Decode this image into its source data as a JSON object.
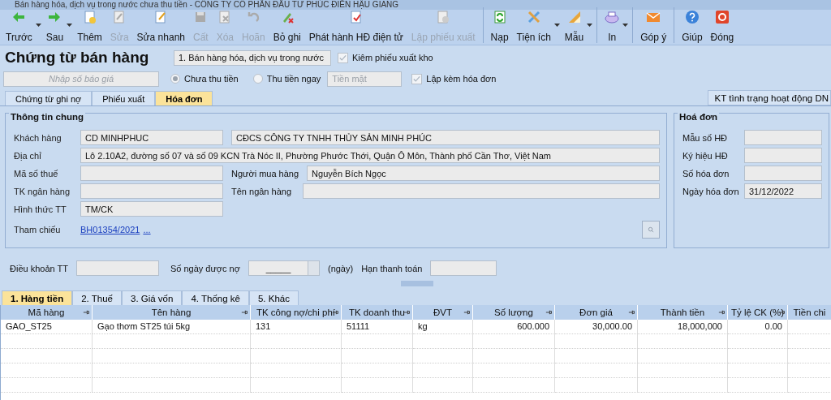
{
  "window": {
    "title": "Bán hàng hóa, dịch vụ trong nước chưa thu tiền - CÔNG TY CỔ PHẦN ĐẦU TƯ PHÚC ĐIỀN HẬU GIANG"
  },
  "toolbar": [
    {
      "label": "Trước",
      "disabled": false,
      "dropdown": true,
      "separator_before": false
    },
    {
      "label": "Sau",
      "disabled": false,
      "dropdown": true,
      "separator_before": false
    },
    {
      "label": "Thêm",
      "disabled": false,
      "dropdown": false,
      "separator_before": false
    },
    {
      "label": "Sửa",
      "disabled": true,
      "dropdown": false,
      "separator_before": false
    },
    {
      "label": "Sửa nhanh",
      "disabled": false,
      "dropdown": false,
      "separator_before": false
    },
    {
      "label": "Cất",
      "disabled": true,
      "dropdown": false,
      "separator_before": false
    },
    {
      "label": "Xóa",
      "disabled": true,
      "dropdown": false,
      "separator_before": false
    },
    {
      "label": "Hoãn",
      "disabled": true,
      "dropdown": false,
      "separator_before": false
    },
    {
      "label": "Bỏ ghi",
      "disabled": false,
      "dropdown": false,
      "separator_before": false
    },
    {
      "label": "Phát hành HĐ điện tử",
      "disabled": false,
      "dropdown": false,
      "separator_before": false
    },
    {
      "label": "Lập phiếu xuất",
      "disabled": true,
      "dropdown": false,
      "separator_before": false
    },
    {
      "label": "Nạp",
      "disabled": false,
      "dropdown": false,
      "separator_before": true
    },
    {
      "label": "Tiện ích",
      "disabled": false,
      "dropdown": true,
      "separator_before": false
    },
    {
      "label": "Mẫu",
      "disabled": false,
      "dropdown": true,
      "separator_before": false
    },
    {
      "label": "In",
      "disabled": false,
      "dropdown": true,
      "separator_before": true
    },
    {
      "label": "Góp ý",
      "disabled": false,
      "dropdown": false,
      "separator_before": true
    },
    {
      "label": "Giúp",
      "disabled": false,
      "dropdown": false,
      "separator_before": true
    },
    {
      "label": "Đóng",
      "disabled": false,
      "dropdown": false,
      "separator_before": false
    }
  ],
  "header": {
    "title": "Chứng từ bán hàng",
    "voucher_type": "1. Bán hàng hóa, dịch vụ trong nước",
    "export_checkbox": {
      "label": "Kiêm phiếu xuất kho",
      "checked": true
    },
    "quote_field": {
      "placeholder": "Nhập số báo giá"
    },
    "payment_radios": [
      {
        "label": "Chưa thu tiền",
        "selected": true
      },
      {
        "label": "Thu tiền ngay",
        "selected": false
      }
    ],
    "payment_field": {
      "placeholder": "Tiền mặt"
    },
    "invoice_checkbox": {
      "label": "Lập kèm hóa đơn",
      "checked": true
    }
  },
  "tabs": [
    {
      "label": "Chứng từ ghi nợ",
      "selected": false
    },
    {
      "label": "Phiếu xuất",
      "selected": false
    },
    {
      "label": "Hóa đơn",
      "selected": true
    }
  ],
  "status_button": {
    "label": "KT tình trạng hoạt động DN"
  },
  "general_info": {
    "title": "Thông tin chung",
    "customer": {
      "label": "Khách hàng",
      "code": "CD MINHPHUC",
      "name": "CĐCS CÔNG TY TNHH THỦY SẢN MINH PHÚC"
    },
    "address": {
      "label": "Địa chỉ",
      "value": "Lô 2.10A2, đường số 07 và số 09 KCN Trà Nóc II, Phường Phước Thới, Quận Ô Môn, Thành phố Cần Thơ, Việt Nam"
    },
    "tax_code": {
      "label": "Mã số thuế"
    },
    "buyer": {
      "label": "Người mua hàng",
      "value": "Nguyễn Bích Ngọc"
    },
    "bank_account": {
      "label": "TK ngân hàng"
    },
    "bank_name": {
      "label": "Tên ngân hàng"
    },
    "payment_method": {
      "label": "Hình thức TT",
      "value": "TM/CK"
    },
    "reference": {
      "label": "Tham chiếu",
      "link": "BH01354/2021",
      "more": "..."
    }
  },
  "invoice": {
    "title": "Hoá đơn",
    "fields": [
      {
        "label": "Mẫu số HĐ"
      },
      {
        "label": "Ký hiệu HĐ"
      },
      {
        "label": "Số hóa đơn"
      },
      {
        "label": "Ngày hóa đơn",
        "value": "31/12/2022"
      }
    ]
  },
  "terms": {
    "terms_label": "Điều khoản TT",
    "days_label": "Số ngày được nợ",
    "days_value": "_____",
    "days_unit": "(ngày)",
    "due_label": "Hạn thanh toán"
  },
  "detail_tabs": [
    {
      "label": "1. Hàng tiền",
      "selected": true
    },
    {
      "label": "2. Thuế",
      "selected": false
    },
    {
      "label": "3. Giá vốn",
      "selected": false
    },
    {
      "label": "4. Thống kê",
      "selected": false
    },
    {
      "label": "5. Khác",
      "selected": false
    }
  ],
  "table": {
    "columns": [
      {
        "label": "Mã hàng",
        "kind": "text"
      },
      {
        "label": "Tên hàng",
        "kind": "text"
      },
      {
        "label": "TK công nợ/chi phí",
        "kind": "text"
      },
      {
        "label": "TK doanh thu",
        "kind": "text"
      },
      {
        "label": "ĐVT",
        "kind": "text"
      },
      {
        "label": "Số lượng",
        "kind": "number"
      },
      {
        "label": "Đơn giá",
        "kind": "number"
      },
      {
        "label": "Thành tiền",
        "kind": "number"
      },
      {
        "label": "Tỷ lệ CK (%)",
        "kind": "number"
      },
      {
        "label": "Tiền chi",
        "kind": "number"
      }
    ],
    "rows": [
      [
        "GAO_ST25",
        "Gạo thơm ST25 túi 5kg",
        "131",
        "51111",
        "kg",
        "600.000",
        "30,000.00",
        "18,000,000",
        "0.00",
        null
      ]
    ]
  }
}
